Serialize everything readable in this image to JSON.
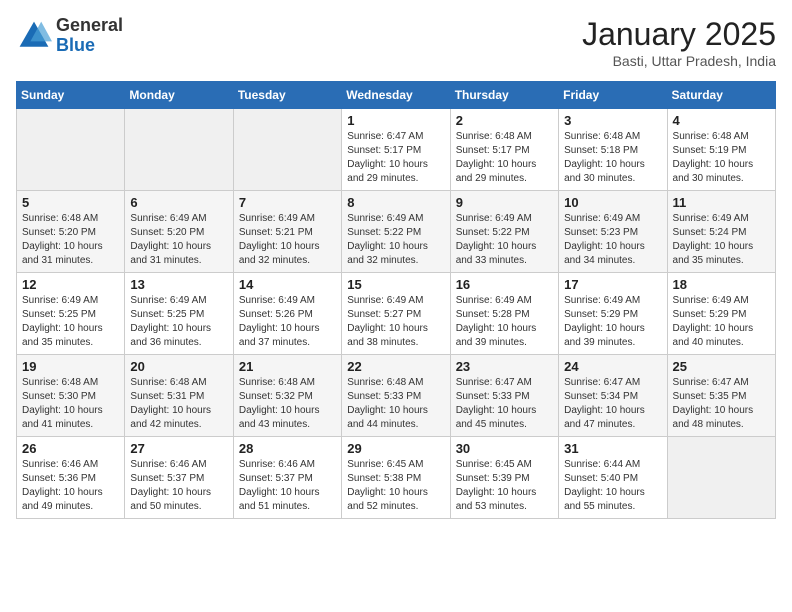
{
  "header": {
    "logo_general": "General",
    "logo_blue": "Blue",
    "title": "January 2025",
    "location": "Basti, Uttar Pradesh, India"
  },
  "calendar": {
    "days_of_week": [
      "Sunday",
      "Monday",
      "Tuesday",
      "Wednesday",
      "Thursday",
      "Friday",
      "Saturday"
    ],
    "weeks": [
      [
        {
          "num": "",
          "sunrise": "",
          "sunset": "",
          "daylight": ""
        },
        {
          "num": "",
          "sunrise": "",
          "sunset": "",
          "daylight": ""
        },
        {
          "num": "",
          "sunrise": "",
          "sunset": "",
          "daylight": ""
        },
        {
          "num": "1",
          "sunrise": "6:47 AM",
          "sunset": "5:17 PM",
          "daylight": "10 hours and 29 minutes."
        },
        {
          "num": "2",
          "sunrise": "6:48 AM",
          "sunset": "5:17 PM",
          "daylight": "10 hours and 29 minutes."
        },
        {
          "num": "3",
          "sunrise": "6:48 AM",
          "sunset": "5:18 PM",
          "daylight": "10 hours and 30 minutes."
        },
        {
          "num": "4",
          "sunrise": "6:48 AM",
          "sunset": "5:19 PM",
          "daylight": "10 hours and 30 minutes."
        }
      ],
      [
        {
          "num": "5",
          "sunrise": "6:48 AM",
          "sunset": "5:20 PM",
          "daylight": "10 hours and 31 minutes."
        },
        {
          "num": "6",
          "sunrise": "6:49 AM",
          "sunset": "5:20 PM",
          "daylight": "10 hours and 31 minutes."
        },
        {
          "num": "7",
          "sunrise": "6:49 AM",
          "sunset": "5:21 PM",
          "daylight": "10 hours and 32 minutes."
        },
        {
          "num": "8",
          "sunrise": "6:49 AM",
          "sunset": "5:22 PM",
          "daylight": "10 hours and 32 minutes."
        },
        {
          "num": "9",
          "sunrise": "6:49 AM",
          "sunset": "5:22 PM",
          "daylight": "10 hours and 33 minutes."
        },
        {
          "num": "10",
          "sunrise": "6:49 AM",
          "sunset": "5:23 PM",
          "daylight": "10 hours and 34 minutes."
        },
        {
          "num": "11",
          "sunrise": "6:49 AM",
          "sunset": "5:24 PM",
          "daylight": "10 hours and 35 minutes."
        }
      ],
      [
        {
          "num": "12",
          "sunrise": "6:49 AM",
          "sunset": "5:25 PM",
          "daylight": "10 hours and 35 minutes."
        },
        {
          "num": "13",
          "sunrise": "6:49 AM",
          "sunset": "5:25 PM",
          "daylight": "10 hours and 36 minutes."
        },
        {
          "num": "14",
          "sunrise": "6:49 AM",
          "sunset": "5:26 PM",
          "daylight": "10 hours and 37 minutes."
        },
        {
          "num": "15",
          "sunrise": "6:49 AM",
          "sunset": "5:27 PM",
          "daylight": "10 hours and 38 minutes."
        },
        {
          "num": "16",
          "sunrise": "6:49 AM",
          "sunset": "5:28 PM",
          "daylight": "10 hours and 39 minutes."
        },
        {
          "num": "17",
          "sunrise": "6:49 AM",
          "sunset": "5:29 PM",
          "daylight": "10 hours and 39 minutes."
        },
        {
          "num": "18",
          "sunrise": "6:49 AM",
          "sunset": "5:29 PM",
          "daylight": "10 hours and 40 minutes."
        }
      ],
      [
        {
          "num": "19",
          "sunrise": "6:48 AM",
          "sunset": "5:30 PM",
          "daylight": "10 hours and 41 minutes."
        },
        {
          "num": "20",
          "sunrise": "6:48 AM",
          "sunset": "5:31 PM",
          "daylight": "10 hours and 42 minutes."
        },
        {
          "num": "21",
          "sunrise": "6:48 AM",
          "sunset": "5:32 PM",
          "daylight": "10 hours and 43 minutes."
        },
        {
          "num": "22",
          "sunrise": "6:48 AM",
          "sunset": "5:33 PM",
          "daylight": "10 hours and 44 minutes."
        },
        {
          "num": "23",
          "sunrise": "6:47 AM",
          "sunset": "5:33 PM",
          "daylight": "10 hours and 45 minutes."
        },
        {
          "num": "24",
          "sunrise": "6:47 AM",
          "sunset": "5:34 PM",
          "daylight": "10 hours and 47 minutes."
        },
        {
          "num": "25",
          "sunrise": "6:47 AM",
          "sunset": "5:35 PM",
          "daylight": "10 hours and 48 minutes."
        }
      ],
      [
        {
          "num": "26",
          "sunrise": "6:46 AM",
          "sunset": "5:36 PM",
          "daylight": "10 hours and 49 minutes."
        },
        {
          "num": "27",
          "sunrise": "6:46 AM",
          "sunset": "5:37 PM",
          "daylight": "10 hours and 50 minutes."
        },
        {
          "num": "28",
          "sunrise": "6:46 AM",
          "sunset": "5:37 PM",
          "daylight": "10 hours and 51 minutes."
        },
        {
          "num": "29",
          "sunrise": "6:45 AM",
          "sunset": "5:38 PM",
          "daylight": "10 hours and 52 minutes."
        },
        {
          "num": "30",
          "sunrise": "6:45 AM",
          "sunset": "5:39 PM",
          "daylight": "10 hours and 53 minutes."
        },
        {
          "num": "31",
          "sunrise": "6:44 AM",
          "sunset": "5:40 PM",
          "daylight": "10 hours and 55 minutes."
        },
        {
          "num": "",
          "sunrise": "",
          "sunset": "",
          "daylight": ""
        }
      ]
    ],
    "labels": {
      "sunrise": "Sunrise:",
      "sunset": "Sunset:",
      "daylight": "Daylight:"
    }
  }
}
